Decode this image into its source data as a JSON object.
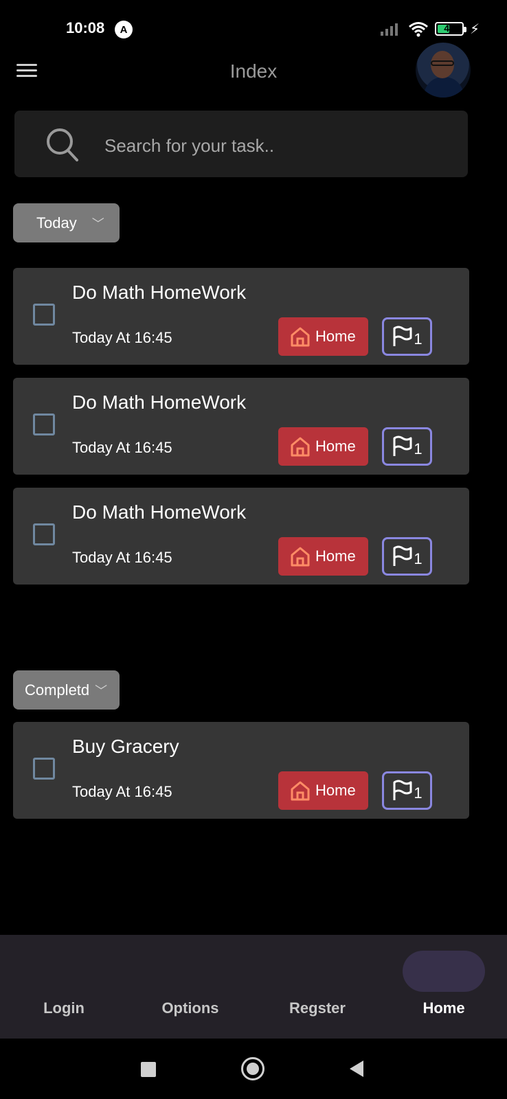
{
  "status_bar": {
    "time": "10:08",
    "app_icon": "A",
    "battery": "43"
  },
  "header": {
    "title": "Index"
  },
  "search": {
    "placeholder": "Search for your task.."
  },
  "sections": {
    "today": {
      "label": "Today"
    },
    "completed": {
      "label": "Completd"
    }
  },
  "tasks_today": [
    {
      "title": "Do Math HomeWork",
      "time": "Today At 16:45",
      "tag": "Home",
      "flag_count": "1"
    },
    {
      "title": "Do Math HomeWork",
      "time": "Today At 16:45",
      "tag": "Home",
      "flag_count": "1"
    },
    {
      "title": "Do Math HomeWork",
      "time": "Today At 16:45",
      "tag": "Home",
      "flag_count": "1"
    }
  ],
  "tasks_completed": [
    {
      "title": "Buy Gracery",
      "time": "Today At 16:45",
      "tag": "Home",
      "flag_count": "1"
    }
  ],
  "bottom_nav": {
    "items": [
      {
        "label": "Login"
      },
      {
        "label": "Options"
      },
      {
        "label": "Regster"
      },
      {
        "label": "Home"
      }
    ],
    "active": "Home"
  },
  "colors": {
    "background": "#000000",
    "card": "#363636",
    "tag": "#b8333a",
    "tag_icon": "#ff8c66",
    "flag_border": "#8a87e0",
    "nav_bg": "#242128"
  },
  "icons": [
    "menu-icon",
    "search-icon",
    "chevron-down-icon",
    "home-icon",
    "flag-icon",
    "wifi-icon",
    "signal-icon",
    "battery-icon"
  ]
}
